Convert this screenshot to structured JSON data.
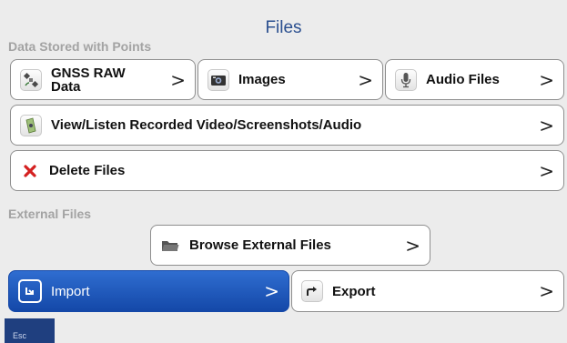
{
  "header": {
    "title": "Files"
  },
  "sections": {
    "stored": "Data Stored with Points",
    "external": "External Files"
  },
  "buttons": {
    "gnss": {
      "label_line1": "GNSS RAW",
      "label_line2": "Data",
      "icon": "satellite-icon"
    },
    "images": {
      "label": "Images",
      "icon": "camera-icon"
    },
    "audio": {
      "label": "Audio Files",
      "icon": "microphone-icon"
    },
    "view_listen": {
      "label": "View/Listen Recorded Video/Screenshots/Audio",
      "icon": "media-icon"
    },
    "delete": {
      "label": "Delete Files",
      "icon": "red-x-icon"
    },
    "browse": {
      "label": "Browse External Files",
      "icon": "folder-icon"
    },
    "import": {
      "label": "Import",
      "icon": "import-arrow-icon",
      "state": "selected"
    },
    "export": {
      "label": "Export",
      "icon": "export-arrow-icon"
    }
  },
  "chevron": ">",
  "esc": {
    "label": "Esc"
  },
  "colors": {
    "accent": "#1f56b8",
    "title": "#2a4f8f",
    "delete": "#d42020"
  }
}
